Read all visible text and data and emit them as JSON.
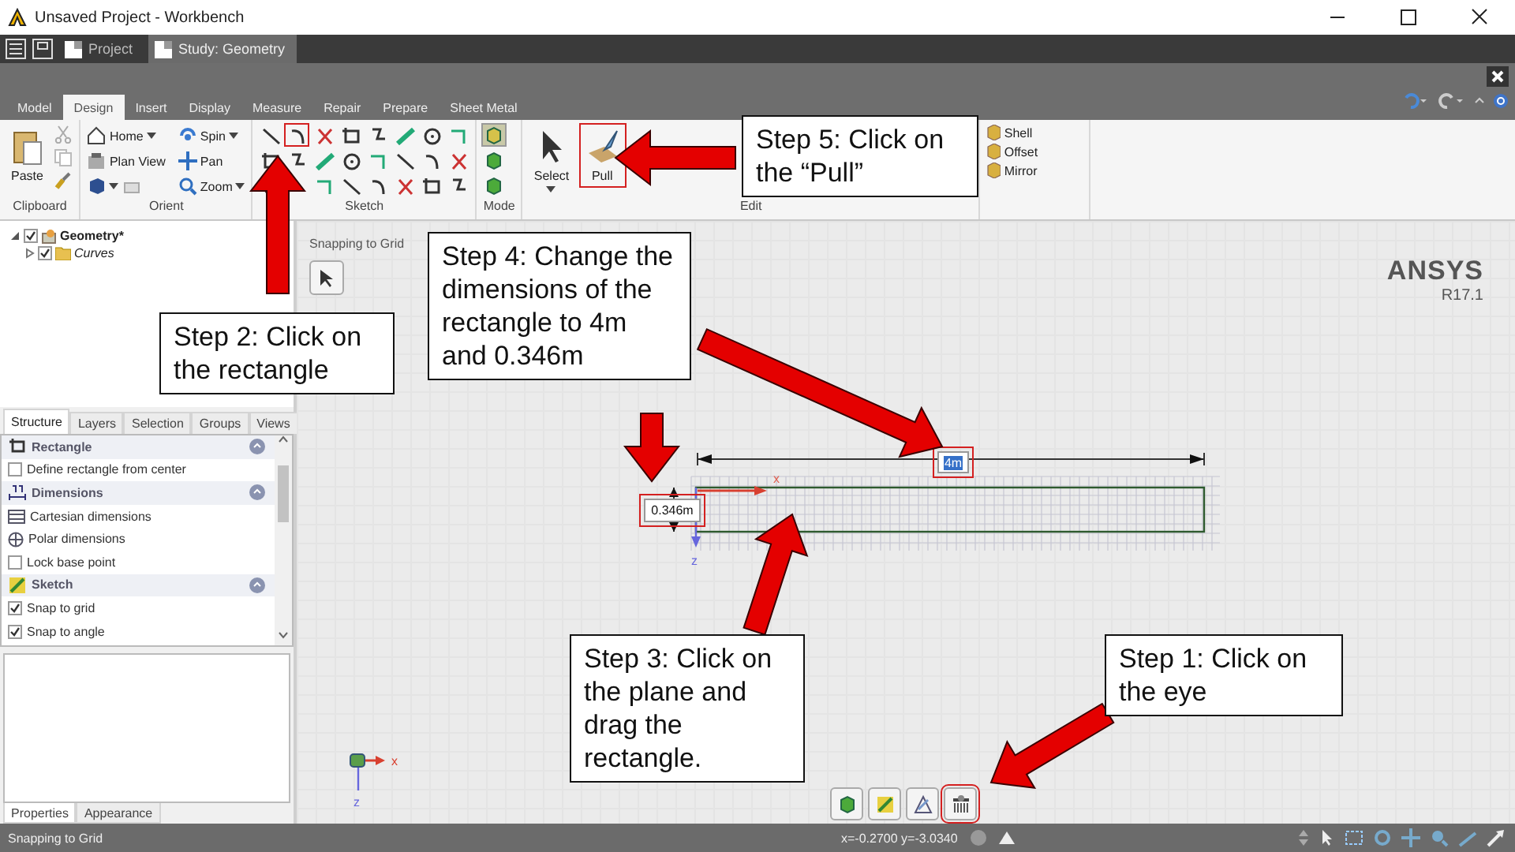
{
  "window": {
    "title": "Unsaved Project - Workbench"
  },
  "app_tabs": [
    {
      "label": "Project",
      "selected": false
    },
    {
      "label": "Study: Geometry",
      "selected": true
    }
  ],
  "ribbon": {
    "tabs": [
      {
        "label": "Model",
        "selected": false
      },
      {
        "label": "Design",
        "selected": true
      },
      {
        "label": "Insert",
        "selected": false
      },
      {
        "label": "Display",
        "selected": false
      },
      {
        "label": "Measure",
        "selected": false
      },
      {
        "label": "Repair",
        "selected": false
      },
      {
        "label": "Prepare",
        "selected": false
      },
      {
        "label": "Sheet Metal",
        "selected": false
      }
    ],
    "groups": [
      {
        "kind": "clipboard",
        "label": "Clipboard",
        "buttons": [
          {
            "label": "Paste"
          }
        ]
      },
      {
        "kind": "orient",
        "label": "Orient",
        "items": [
          {
            "label": "Home",
            "dropdown": true
          },
          {
            "label": "Spin",
            "dropdown": true
          },
          {
            "label": "Plan View",
            "dropdown": false
          },
          {
            "label": "Pan",
            "dropdown": false
          },
          {
            "dropdown": true
          },
          {
            "label": "Zoom",
            "dropdown": true
          }
        ]
      },
      {
        "kind": "tool_grid",
        "label": "Sketch",
        "tools": [
          {
            "highlighted": false
          },
          {
            "highlighted": true
          },
          {
            "highlighted": false
          },
          {
            "highlighted": false
          },
          {
            "highlighted": false
          },
          {
            "highlighted": false
          },
          {
            "highlighted": false
          },
          {
            "highlighted": false
          },
          {
            "highlighted": false
          },
          {
            "highlighted": false
          },
          {
            "highlighted": false
          },
          {
            "highlighted": false
          },
          {
            "highlighted": false
          },
          {
            "highlighted": false
          },
          {
            "highlighted": false
          },
          {
            "highlighted": false
          },
          {
            "highlighted": false
          },
          {
            "highlighted": false
          },
          {
            "highlighted": false
          },
          {
            "highlighted": false
          },
          {
            "highlighted": false
          },
          {
            "highlighted": false
          },
          {
            "highlighted": false
          }
        ]
      },
      {
        "kind": "tool_column",
        "label": "Mode",
        "tools": [
          {
            "selected": true
          },
          {
            "selected": false
          },
          {
            "selected": false
          }
        ]
      },
      {
        "kind": "large_buttons",
        "label": "Edit",
        "buttons": [
          {
            "label": "Select",
            "dropdown": true,
            "highlighted": false
          },
          {
            "label": "Pull",
            "dropdown": false,
            "highlighted": true
          }
        ]
      },
      {
        "kind": "small_list",
        "items": [
          {
            "label": "Shell"
          },
          {
            "label": "Offset"
          },
          {
            "label": "Mirror"
          }
        ]
      }
    ]
  },
  "tree": [
    {
      "label": "Geometry*",
      "checked": true,
      "expanded": true,
      "children": [
        {
          "label": "Curves",
          "checked": true,
          "expanded": false
        }
      ]
    }
  ],
  "panel_tabs": [
    {
      "label": "Structure",
      "selected": true
    },
    {
      "label": "Layers",
      "selected": false
    },
    {
      "label": "Selection",
      "selected": false
    },
    {
      "label": "Groups",
      "selected": false
    },
    {
      "label": "Views",
      "selected": false
    }
  ],
  "options": [
    {
      "kind": "section",
      "label": "Rectangle"
    },
    {
      "kind": "checkbox",
      "label": "Define rectangle from center",
      "checked": false
    },
    {
      "kind": "section",
      "label": "Dimensions"
    },
    {
      "kind": "option",
      "label": "Cartesian dimensions"
    },
    {
      "kind": "option",
      "label": "Polar dimensions"
    },
    {
      "kind": "checkbox",
      "label": "Lock base point",
      "checked": false
    },
    {
      "kind": "section",
      "label": "Sketch"
    },
    {
      "kind": "checkbox",
      "label": "Snap to grid",
      "checked": true
    },
    {
      "kind": "checkbox",
      "label": "Snap to angle",
      "checked": true
    }
  ],
  "bottom_tabs": [
    {
      "label": "Properties",
      "selected": true
    },
    {
      "label": "Appearance",
      "selected": false
    }
  ],
  "canvas": {
    "hint": "Snapping to Grid",
    "logo": "ANSYS",
    "version": "R17.1",
    "width_dimension": {
      "value": "4m",
      "selected": true,
      "highlighted": true
    },
    "height_dimension": {
      "value": "0.346m",
      "selected": false,
      "highlighted": true
    },
    "axis_x": "x",
    "axis_z": "z",
    "triad_x": "x",
    "triad_z": "z",
    "view_buttons": [
      {
        "highlighted": false
      },
      {
        "highlighted": false
      },
      {
        "highlighted": false
      },
      {
        "highlighted": true
      }
    ]
  },
  "status_bar": {
    "message": "Snapping to Grid",
    "coordinates": "x=-0.2700  y=-3.0340"
  },
  "callouts": [
    {
      "text": "Step 5: Click on the “Pull”"
    },
    {
      "text": "Step 4: Change the dimensions of the rectangle to 4m and 0.346m"
    },
    {
      "text": "Step 2: Click on the rectangle"
    },
    {
      "text": "Step 3: Click on the plane and drag the rectangle."
    },
    {
      "text": "Step 1: Click on the eye"
    }
  ]
}
